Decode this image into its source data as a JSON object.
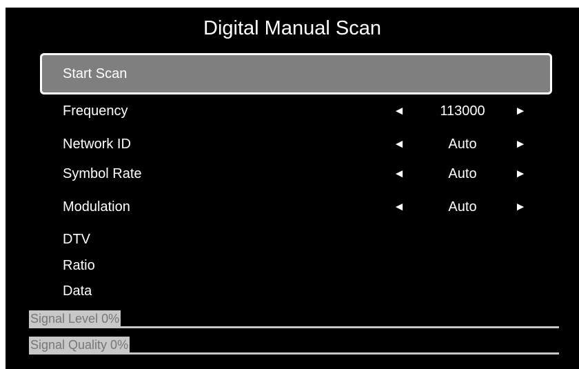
{
  "title": "Digital Manual Scan",
  "start_scan": {
    "label": "Start Scan"
  },
  "settings": [
    {
      "key": "frequency",
      "label": "Frequency",
      "value": "113000",
      "left_icon": "triangle-left-icon",
      "right_icon": "triangle-right-icon"
    },
    {
      "key": "network-id",
      "label": "Network ID",
      "value": "Auto",
      "left_icon": "triangle-left-icon",
      "right_icon": "triangle-right-icon"
    },
    {
      "key": "symbol-rate",
      "label": "Symbol Rate",
      "value": "Auto",
      "left_icon": "triangle-left-icon",
      "right_icon": "triangle-right-icon"
    },
    {
      "key": "modulation",
      "label": "Modulation",
      "value": "Auto",
      "left_icon": "triangle-left-icon",
      "right_icon": "triangle-right-icon"
    }
  ],
  "arrows": {
    "left": "◄",
    "right": "►"
  },
  "info_rows": [
    {
      "label": "DTV"
    },
    {
      "label": "Ratio"
    },
    {
      "label": "Data"
    }
  ],
  "meters": {
    "signal_level": {
      "label": "Signal Level 0%",
      "fraction": 0
    },
    "signal_quality": {
      "label": "Signal Quality 0%",
      "fraction": 0
    }
  },
  "colors": {
    "background": "#000000",
    "highlight": "#7f7f7f",
    "meter_label_bg": "#c8c8c8",
    "meter_label_text": "#777777"
  }
}
